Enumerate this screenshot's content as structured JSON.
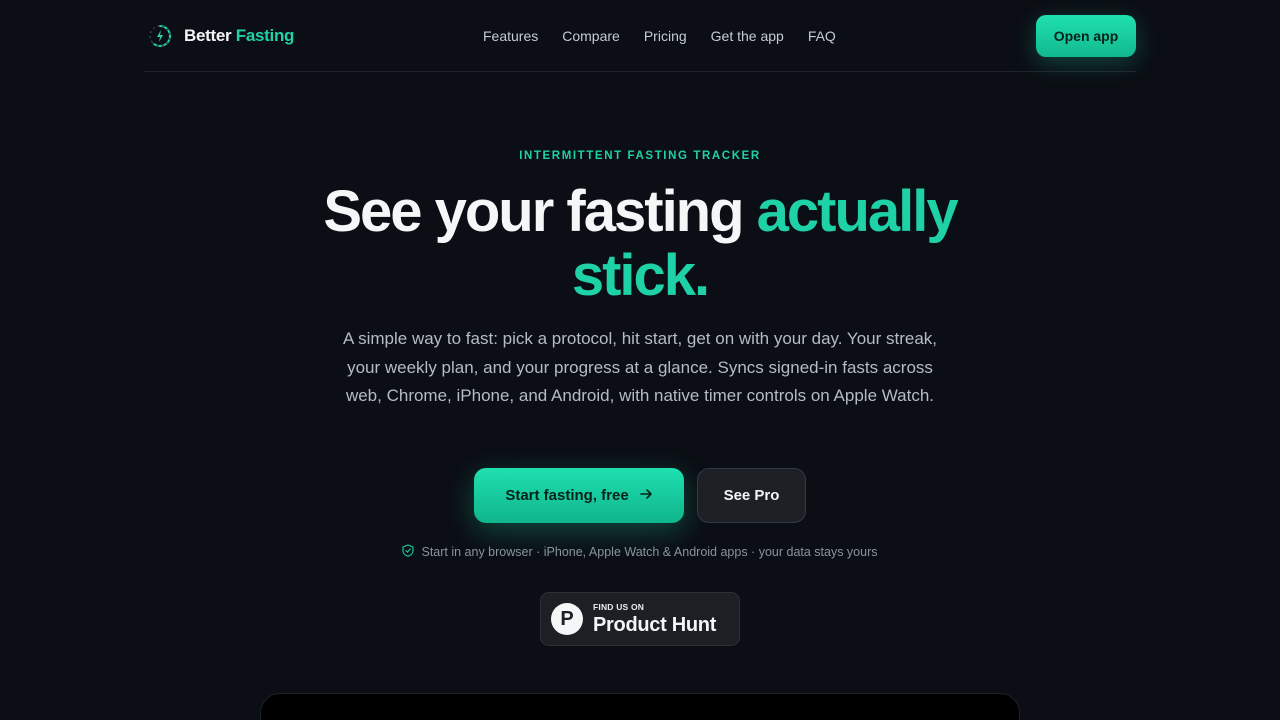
{
  "brand": {
    "name_part1": "Better",
    "name_part2": "Fasting",
    "logo_icon": "timer-bolt-icon"
  },
  "nav": {
    "items": [
      "Features",
      "Compare",
      "Pricing",
      "Get the app",
      "FAQ"
    ]
  },
  "header": {
    "open_app_label": "Open app"
  },
  "hero": {
    "eyebrow": "INTERMITTENT FASTING TRACKER",
    "headline_white": "See your fasting",
    "headline_green_1": "actually",
    "headline_green_2": "stick.",
    "subtitle": "A simple way to fast: pick a protocol, hit start, get on with your day. Your streak, your weekly plan, and your progress at a glance. Syncs signed-in fasts across web, Chrome, iPhone, and Android, with native timer controls on Apple Watch.",
    "primary_cta": "Start fasting, free",
    "primary_cta_icon": "arrow-right-icon",
    "secondary_cta": "See Pro",
    "trust_icon": "shield-check-icon",
    "trust_text": "Start in any browser · iPhone, Apple Watch & Android apps · your data stays yours"
  },
  "product_hunt": {
    "small_text": "FIND US ON",
    "big_text": "Product Hunt",
    "letter": "P"
  },
  "colors": {
    "accent": "#1fd1a6",
    "background": "#0b0e14",
    "text": "#f4f6f8",
    "muted": "#b4bcc5"
  }
}
